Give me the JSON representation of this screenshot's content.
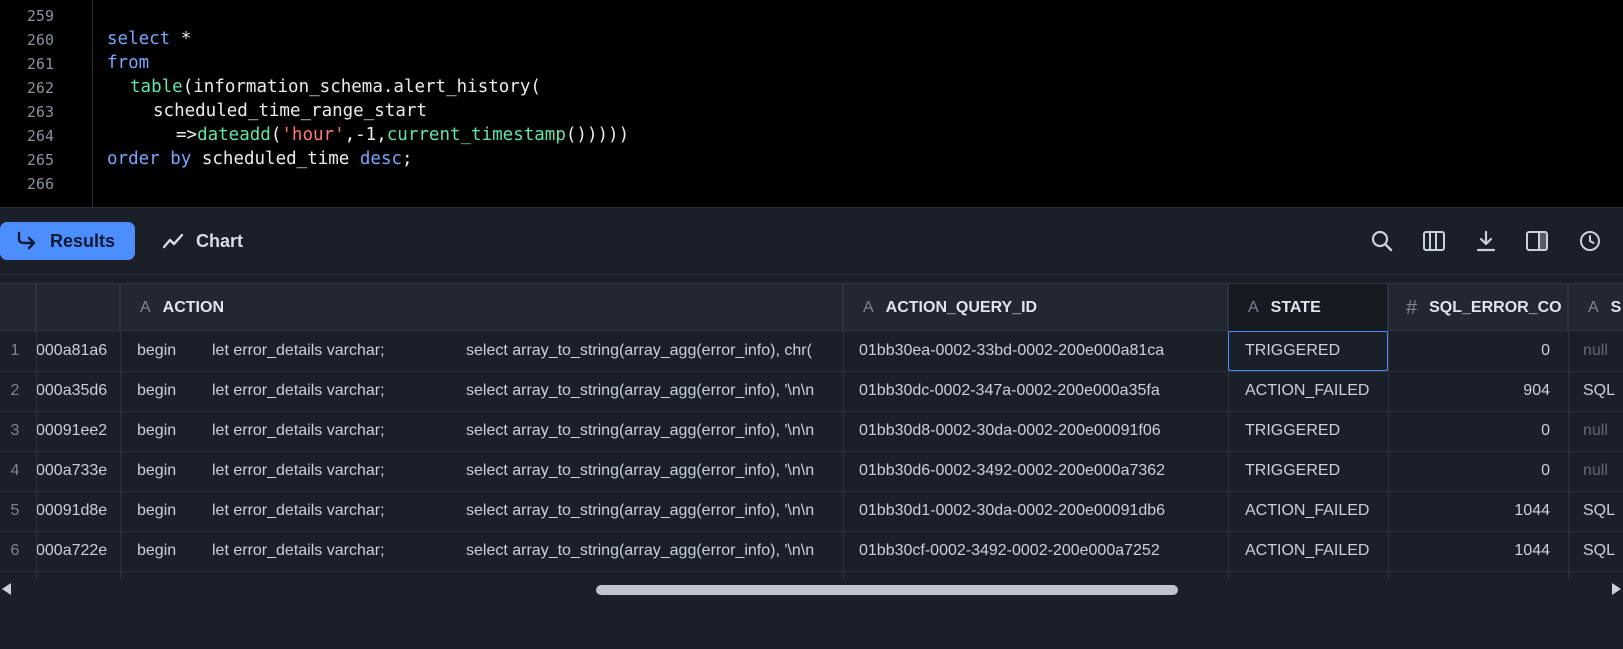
{
  "editor": {
    "line_numbers": [
      "259",
      "260",
      "261",
      "262",
      "263",
      "264",
      "265",
      "266"
    ],
    "lines": {
      "l260_kw": "select",
      "l260_rest": " *",
      "l261_kw": "from",
      "l262_fn": "table",
      "l262_rest": "(information_schema.alert_history(",
      "l263_rest": "scheduled_time_range_start",
      "l264_arrow": "=>",
      "l264_fn": "dateadd",
      "l264_p1": "(",
      "l264_str": "'hour'",
      "l264_p2": ",-1,",
      "l264_fn2": "current_timestamp",
      "l264_p3": "()))))",
      "l265_kw1": "order by",
      "l265_mid": " scheduled_time ",
      "l265_kw2": "desc",
      "l265_end": ";"
    }
  },
  "toolbar": {
    "results_label": "Results",
    "chart_label": "Chart",
    "icons": [
      "search-icon",
      "columns-icon",
      "download-icon",
      "panel-icon",
      "history-icon"
    ]
  },
  "grid": {
    "columns": {
      "action": "ACTION",
      "action_query_id": "ACTION_QUERY_ID",
      "state": "STATE",
      "sql_error_code": "SQL_ERROR_CO",
      "next": "S"
    },
    "type_icons": {
      "text": "A",
      "number": "#"
    },
    "rows": [
      {
        "n": "1",
        "prev": "000a81a6",
        "a1": "begin",
        "a2": "let error_details varchar;",
        "a3": "select array_to_string(array_agg(error_info), chr(",
        "qid": "01bb30ea-0002-33bd-0002-200e000a81ca",
        "state": "TRIGGERED",
        "err": "0",
        "msg": "null"
      },
      {
        "n": "2",
        "prev": "000a35d6",
        "a1": "begin",
        "a2": "let error_details varchar;",
        "a3": "select array_to_string(array_agg(error_info), '\\n\\n",
        "qid": "01bb30dc-0002-347a-0002-200e000a35fa",
        "state": "ACTION_FAILED",
        "err": "904",
        "msg": "SQL"
      },
      {
        "n": "3",
        "prev": "00091ee2",
        "a1": "begin",
        "a2": "let error_details varchar;",
        "a3": "select array_to_string(array_agg(error_info), '\\n\\n",
        "qid": "01bb30d8-0002-30da-0002-200e00091f06",
        "state": "TRIGGERED",
        "err": "0",
        "msg": "null"
      },
      {
        "n": "4",
        "prev": "000a733e",
        "a1": "begin",
        "a2": "let error_details varchar;",
        "a3": "select array_to_string(array_agg(error_info), '\\n\\n",
        "qid": "01bb30d6-0002-3492-0002-200e000a7362",
        "state": "TRIGGERED",
        "err": "0",
        "msg": "null"
      },
      {
        "n": "5",
        "prev": "00091d8e",
        "a1": "begin",
        "a2": "let error_details varchar;",
        "a3": "select array_to_string(array_agg(error_info), '\\n\\n",
        "qid": "01bb30d1-0002-30da-0002-200e00091db6",
        "state": "ACTION_FAILED",
        "err": "1044",
        "msg": "SQL"
      },
      {
        "n": "6",
        "prev": "000a722e",
        "a1": "begin",
        "a2": "let error_details varchar;",
        "a3": "select array_to_string(array_agg(error_info), '\\n\\n",
        "qid": "01bb30cf-0002-3492-0002-200e000a7252",
        "state": "ACTION_FAILED",
        "err": "1044",
        "msg": "SQL"
      }
    ]
  },
  "colors": {
    "accent": "#4d8eff",
    "editor_bg": "#000000",
    "panel_bg": "#1b1f27"
  }
}
